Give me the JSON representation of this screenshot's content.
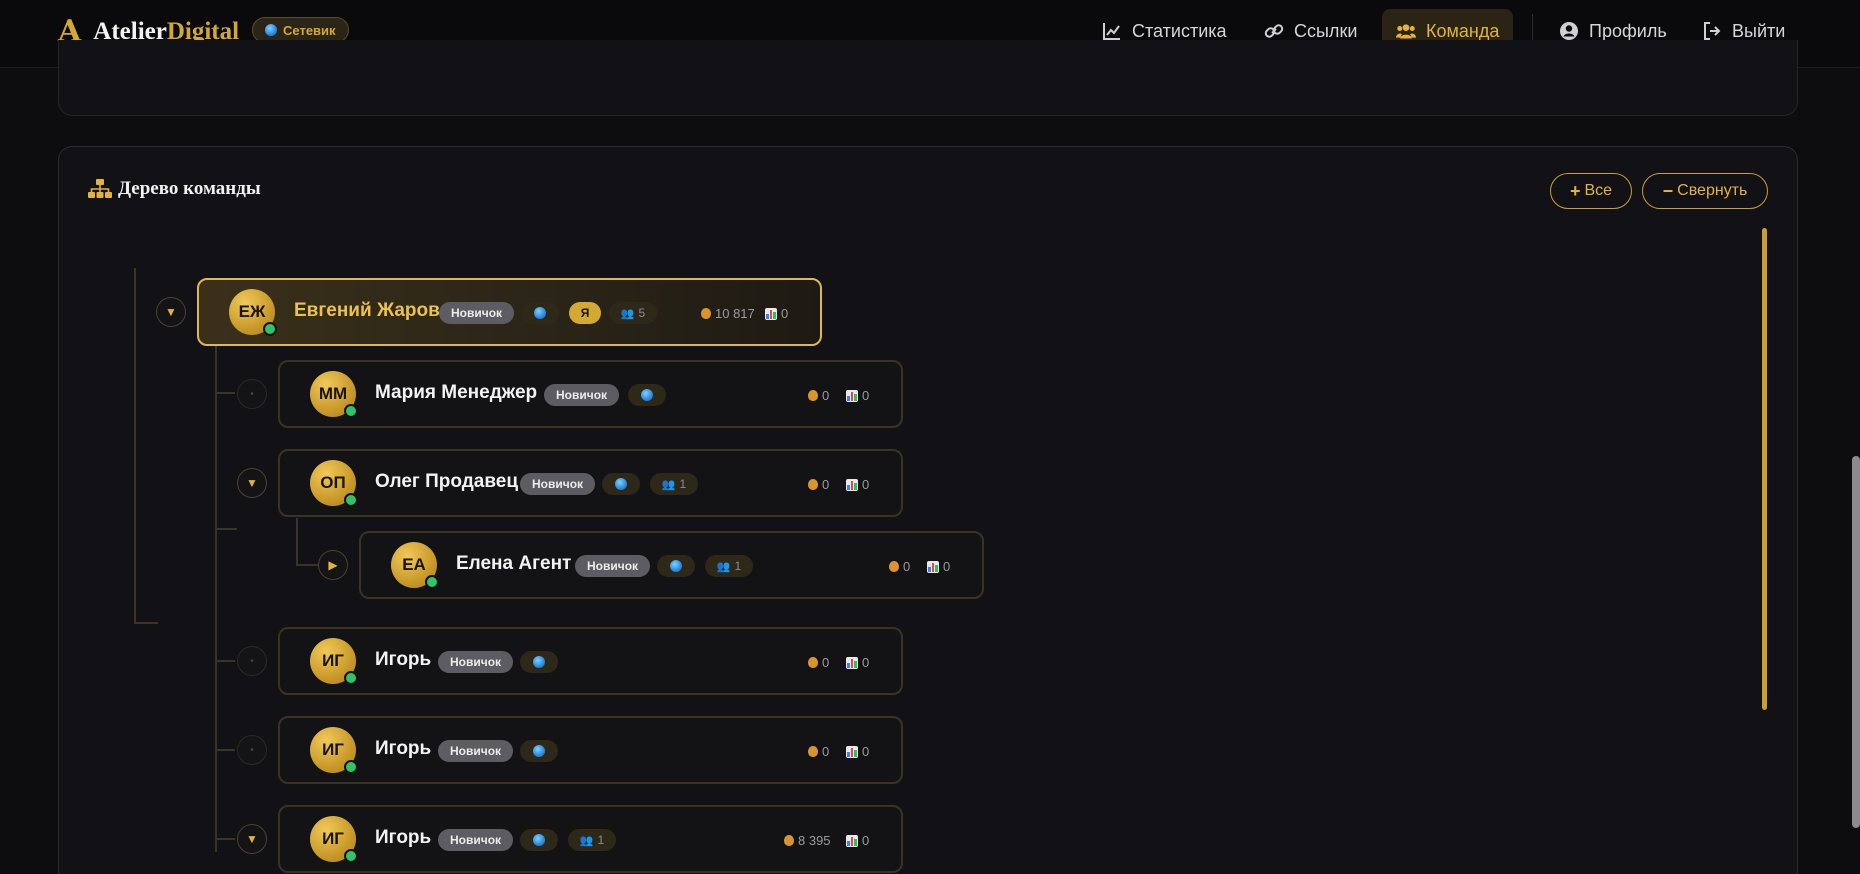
{
  "header": {
    "logo_mark": "A",
    "brand_part1": "Atelier",
    "brand_part2": "Digital",
    "role_badge": "Сетевик",
    "nav": [
      {
        "label": "Статистика",
        "icon": "chart-line-icon"
      },
      {
        "label": "Ссылки",
        "icon": "link-icon"
      },
      {
        "label": "Команда",
        "icon": "users-icon",
        "active": true
      },
      {
        "label": "Профиль",
        "icon": "user-circle-icon"
      },
      {
        "label": "Выйти",
        "icon": "logout-icon"
      }
    ]
  },
  "team_tree": {
    "title": "Дерево команды",
    "expand_all_label": "Все",
    "collapse_label": "Свернуть",
    "nodes": [
      {
        "initials": "ЕЖ",
        "name": "Евгений Жаров",
        "rank": "Новичок",
        "me_label": "Я",
        "team_count": "5",
        "earnings": "10 817",
        "sales": "0",
        "toggle": "▼"
      },
      {
        "initials": "ММ",
        "name": "Мария Менеджер",
        "rank": "Новичок",
        "earnings": "0",
        "sales": "0",
        "toggle": "•"
      },
      {
        "initials": "ОП",
        "name": "Олег Продавец",
        "rank": "Новичок",
        "team_count": "1",
        "earnings": "0",
        "sales": "0",
        "toggle": "▼"
      },
      {
        "initials": "ЕА",
        "name": "Елена Агент",
        "rank": "Новичок",
        "team_count": "1",
        "earnings": "0",
        "sales": "0",
        "toggle": "▶"
      },
      {
        "initials": "ИГ",
        "name": "Игорь",
        "rank": "Новичок",
        "earnings": "0",
        "sales": "0",
        "toggle": "•"
      },
      {
        "initials": "ИГ",
        "name": "Игорь",
        "rank": "Новичок",
        "earnings": "0",
        "sales": "0",
        "toggle": "•"
      },
      {
        "initials": "ИГ",
        "name": "Игорь",
        "rank": "Новичок",
        "team_count": "1",
        "earnings": "8 395",
        "sales": "0",
        "toggle": "▼"
      }
    ]
  },
  "colors": {
    "accent": "#d4a932",
    "background": "#0d0d10",
    "online": "#31c26a"
  }
}
